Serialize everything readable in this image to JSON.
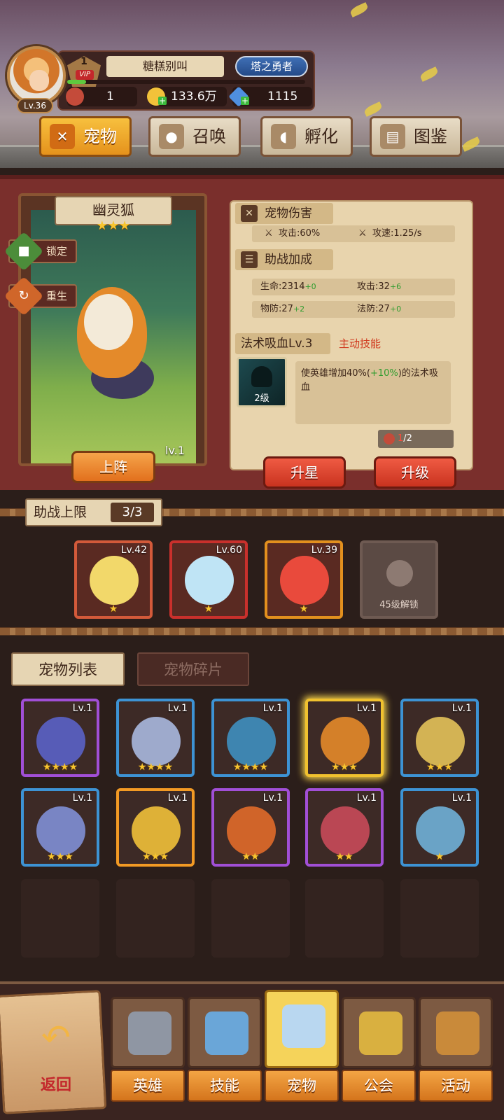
{
  "player": {
    "level": "Lv.36",
    "vip_level": "1",
    "vip_label": "VIP",
    "name": "糖糕别叫",
    "title": "塔之勇者",
    "exp_fraction": 0.08
  },
  "resources": {
    "energy": "1",
    "gold": "133.6万",
    "gems": "1115"
  },
  "top_tabs": [
    {
      "label": "宠物",
      "icon": "pet-cat-icon",
      "glyph": "✕",
      "active": true
    },
    {
      "label": "召唤",
      "icon": "paw-icon",
      "glyph": "●",
      "active": false
    },
    {
      "label": "孵化",
      "icon": "egg-icon",
      "glyph": "◖",
      "active": false
    },
    {
      "label": "图鉴",
      "icon": "book-icon",
      "glyph": "▤",
      "active": false
    }
  ],
  "pet": {
    "name": "幽灵狐",
    "stars": "★★★",
    "level": "lv.1",
    "lock_label": "锁定",
    "rebirth_label": "重生",
    "deploy_label": "上阵"
  },
  "damage": {
    "title": "宠物伤害",
    "attack": "攻击:60%",
    "attack_speed": "攻速:1.25/s"
  },
  "assist_bonus": {
    "title": "助战加成",
    "hp": "生命:2314",
    "hp_bonus": "+0",
    "atk": "攻击:32",
    "atk_bonus": "+6",
    "pdef": "物防:27",
    "pdef_bonus": "+2",
    "mdef": "法防:27",
    "mdef_bonus": "+0"
  },
  "skill": {
    "name": "法术吸血Lv.3",
    "type": "主动技能",
    "level_badge": "2级",
    "desc_pre": "使英雄增加40%(",
    "desc_bonus": "+10%",
    "desc_post": ")的法术吸血",
    "shards_have": "1",
    "shards_need": "/2"
  },
  "actions": {
    "star_up": "升星",
    "level_up": "升级"
  },
  "assist": {
    "label": "助战上限",
    "count": "3/3",
    "slots": [
      {
        "level": "Lv.42",
        "stars": "★",
        "color": "#d35a3a",
        "art": "#f2d86a"
      },
      {
        "level": "Lv.60",
        "stars": "★",
        "color": "#c9302c",
        "art": "#bfe4f5"
      },
      {
        "level": "Lv.39",
        "stars": "★",
        "color": "#e2901e",
        "art": "#e94a3c"
      }
    ],
    "locked_text": "45级解锁"
  },
  "list_tabs": {
    "pets": "宠物列表",
    "shards": "宠物碎片"
  },
  "pet_list": [
    {
      "level": "Lv.1",
      "stars": "★★★★",
      "border": "#a14fd6",
      "art": "#5a62c8"
    },
    {
      "level": "Lv.1",
      "stars": "★★★★",
      "border": "#3d93d4",
      "art": "#a9b8df"
    },
    {
      "level": "Lv.1",
      "stars": "★★★★",
      "border": "#3d93d4",
      "art": "#3e8fc0"
    },
    {
      "level": "Lv.1",
      "stars": "★★★",
      "border": "#f0c12f",
      "art": "#e48a2a"
    },
    {
      "level": "Lv.1",
      "stars": "★★★",
      "border": "#3d93d4",
      "art": "#e3c25a"
    },
    {
      "level": "Lv.1",
      "stars": "★★★",
      "border": "#3d93d4",
      "art": "#7f8fd6"
    },
    {
      "level": "Lv.1",
      "stars": "★★★",
      "border": "#f29a24",
      "art": "#f0c03a"
    },
    {
      "level": "Lv.1",
      "stars": "★★",
      "border": "#a14fd6",
      "art": "#e06a2a"
    },
    {
      "level": "Lv.1",
      "stars": "★★",
      "border": "#a14fd6",
      "art": "#c84a5a"
    },
    {
      "level": "Lv.1",
      "stars": "★",
      "border": "#3d93d4",
      "art": "#6fb0d8"
    }
  ],
  "bottom_nav": {
    "back": "返回",
    "items": [
      {
        "label": "英雄",
        "icon": "helmet-icon",
        "color": "#8f96a3"
      },
      {
        "label": "技能",
        "icon": "spellbook-icon",
        "color": "#6aa6d8"
      },
      {
        "label": "宠物",
        "icon": "winged-emblem-icon",
        "color": "#b9d7f0",
        "active": true
      },
      {
        "label": "公会",
        "icon": "guild-crest-icon",
        "color": "#d9b040"
      },
      {
        "label": "活动",
        "icon": "horn-icon",
        "color": "#c98a3a"
      }
    ]
  }
}
